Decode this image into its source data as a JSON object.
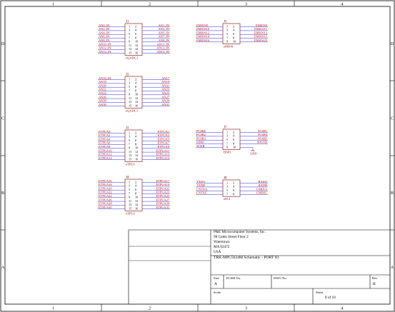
{
  "border": {
    "columns": [
      "1",
      "2",
      "3",
      "4"
    ],
    "rows": [
      "D",
      "C",
      "B",
      "A"
    ]
  },
  "colors": {
    "line": "#000000",
    "net": "#c00000",
    "wire": "#2a2ad0",
    "body": "#7a0000",
    "ref": "#800000"
  },
  "components": [
    {
      "ref": "J1",
      "value": "eQADC1",
      "pins": [
        [
          "1",
          "2"
        ],
        [
          "3",
          "4"
        ],
        [
          "5",
          "6"
        ],
        [
          "7",
          "8"
        ],
        [
          "9",
          "10"
        ],
        [
          "11",
          "12"
        ],
        [
          "13",
          "14"
        ],
        [
          "15",
          "16"
        ]
      ],
      "left": [
        "AN0_IN",
        "AN2_IN",
        "AN4_IN",
        "AN6_IN",
        "AN8_IN",
        "AN10_IN",
        "AN12_IN",
        "AN14_IN"
      ],
      "right": [
        "AN1_IN",
        "AN3_IN",
        "AN5_IN",
        "AN7_IN",
        "AN9_IN",
        "AN11_IN",
        "AN13_IN",
        "AN15_IN"
      ]
    },
    {
      "ref": "J2",
      "value": "eQADC1",
      "pins": [
        [
          "1",
          "2"
        ],
        [
          "3",
          "4"
        ],
        [
          "5",
          "6"
        ],
        [
          "7",
          "8"
        ],
        [
          "9",
          "10"
        ],
        [
          "11",
          "12"
        ],
        [
          "13",
          "14"
        ],
        [
          "15",
          "16"
        ]
      ],
      "left": [
        "AN16_IN",
        "AN18",
        "AN20",
        "AN22",
        "AN24",
        "AN26",
        "AN28",
        "AN30"
      ],
      "right": [
        "AN17",
        "AN19",
        "AN21",
        "AN23",
        "AN25",
        "AN27",
        "AN29",
        "AN31"
      ]
    },
    {
      "ref": "J3",
      "value": "eTPU1",
      "pins": [
        [
          "1",
          "2"
        ],
        [
          "3",
          "4"
        ],
        [
          "5",
          "6"
        ],
        [
          "7",
          "8"
        ],
        [
          "9",
          "10"
        ],
        [
          "11",
          "12"
        ],
        [
          "13",
          "14"
        ],
        [
          "15",
          "16"
        ]
      ],
      "left": [
        "ETPUA0",
        "ETPUA2",
        "ETPUA4",
        "ETPUA6",
        "ETPUA8",
        "ETPUA10",
        "ETPUA12",
        "ETPUA14"
      ],
      "right": [
        "ETPUA1",
        "ETPUA3",
        "ETPUA5",
        "ETPUA7",
        "ETPUA9",
        "ETPUA11",
        "ETPUA13",
        "ETPUA15"
      ]
    },
    {
      "ref": "J4",
      "value": "eTPU2",
      "pins": [
        [
          "1",
          "2"
        ],
        [
          "3",
          "4"
        ],
        [
          "5",
          "6"
        ],
        [
          "7",
          "8"
        ],
        [
          "9",
          "10"
        ],
        [
          "11",
          "12"
        ],
        [
          "13",
          "14"
        ],
        [
          "15",
          "16"
        ]
      ],
      "left": [
        "ETPUA16",
        "ETPUA18",
        "ETPUA20",
        "ETPUA22",
        "ETPUA24",
        "ETPUA26",
        "ETPUA28",
        "ETPUA30"
      ],
      "right": [
        "ETPUA17",
        "ETPUA19",
        "ETPUA21",
        "ETPUA23",
        "ETPUA25",
        "ETPUA27",
        "ETPUA29",
        "ETPUA31"
      ]
    },
    {
      "ref": "J5",
      "value": "eMIOS",
      "pins": [
        [
          "1",
          "2"
        ],
        [
          "3",
          "4"
        ],
        [
          "5",
          "6"
        ],
        [
          "7",
          "8"
        ],
        [
          "9",
          "10"
        ]
      ],
      "left": [
        "EMIOS8",
        "EMIOS10",
        "EMIOS12",
        "EMIOS14",
        "EMIOS16"
      ],
      "right": [
        "EMIOS9",
        "EMIOS11",
        "EMIOS13",
        "EMIOS15",
        "EMIOS23"
      ]
    },
    {
      "ref": "J7",
      "value": "DSPI",
      "pins": [
        [
          "1",
          "2"
        ],
        [
          "3",
          "4"
        ],
        [
          "5",
          "6"
        ],
        [
          "7",
          "8"
        ],
        [
          "9",
          "10"
        ]
      ],
      "left": [
        "PCSB0",
        "PCSB2",
        "PCSB3",
        "SINB",
        "SCKB"
      ],
      "right": [
        "PCSB1",
        "PCSB4",
        "PCSB5",
        "SOUTB",
        ""
      ],
      "gnd": "GND"
    },
    {
      "ref": "J8",
      "value": "eSCI",
      "pins": [
        [
          "1",
          "2"
        ],
        [
          "3",
          "4"
        ],
        [
          "5",
          "6"
        ],
        [
          "7",
          "8"
        ]
      ],
      "left": [
        "TXDA",
        "TXDB",
        "CNTXA",
        "CNTXC"
      ],
      "right": [
        "RXDA",
        "RXDB",
        "CNRXA",
        "CNRXC"
      ]
    }
  ],
  "title_block": {
    "company": [
      "P&E Microcomputer Systems, Inc.",
      "98 Galen Street Floor 2",
      "Watertown",
      "MA 02472",
      "USA"
    ],
    "title": "TRK-MPC5634M Schematic - PORT IO",
    "size_label": "Size",
    "size": "A",
    "fcsm_label": "FCSM No.",
    "dwg_label": "DWG No.",
    "rev_label": "Rev",
    "rev": "B",
    "scale_label": "Scale",
    "sheet_label": "Sheet",
    "sheet": "8 of 10"
  }
}
